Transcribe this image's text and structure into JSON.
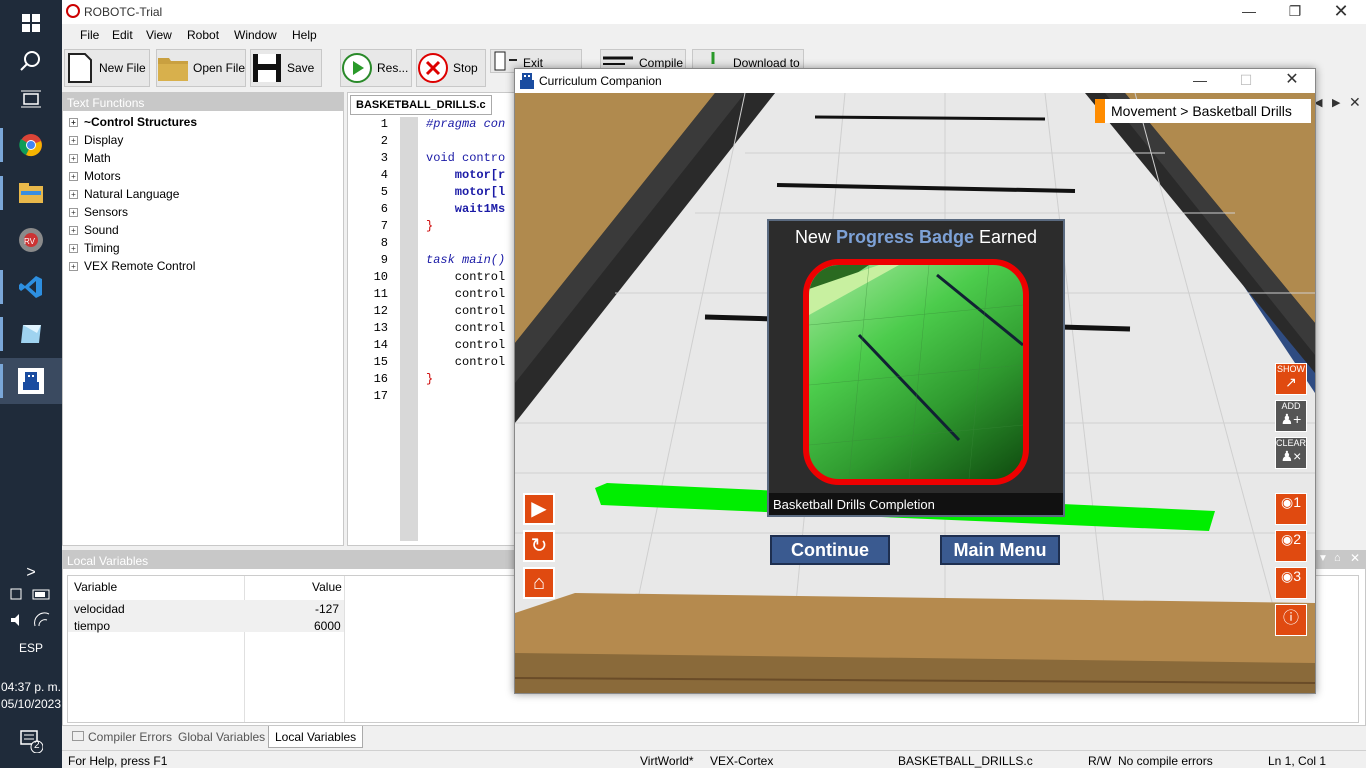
{
  "taskbar": {
    "time": "04:37 p. m.",
    "date": "05/10/2023",
    "language": "ESP",
    "notification_count": "2"
  },
  "window": {
    "title": "ROBOTC-Trial"
  },
  "menu": [
    "File",
    "Edit",
    "View",
    "Robot",
    "Window",
    "Help"
  ],
  "toolbar": {
    "new_file": "New File",
    "open_file": "Open File",
    "save": "Save",
    "resume": "Res...",
    "stop": "Stop",
    "exit": "Exit",
    "compile": "Compile",
    "download": "Download to"
  },
  "text_functions": {
    "header": "Text Functions",
    "items": [
      "~Control Structures",
      "Display",
      "Math",
      "Motors",
      "Natural Language",
      "Sensors",
      "Sound",
      "Timing",
      "VEX Remote Control"
    ]
  },
  "editor": {
    "tab": "BASKETBALL_DRILLS.c",
    "lines": [
      "#pragma con",
      "",
      "void contro",
      "    motor[r",
      "    motor[l",
      "    wait1Ms",
      "}",
      "",
      "task main()",
      "    control",
      "    control",
      "    control",
      "    control",
      "    control",
      "    control",
      "}",
      ""
    ]
  },
  "local_variables": {
    "header": "Local Variables",
    "col_variable": "Variable",
    "col_value": "Value",
    "rows": [
      {
        "name": "velocidad",
        "value": "-127"
      },
      {
        "name": "tiempo",
        "value": "6000"
      }
    ]
  },
  "bottom_tabs": [
    "Compiler Errors",
    "Global Variables",
    "Local Variables"
  ],
  "status": {
    "help": "For Help, press F1",
    "world": "VirtWorld*",
    "platform": "VEX-Cortex",
    "file": "BASKETBALL_DRILLS.c",
    "mode": "R/W",
    "compile": "No compile errors",
    "position": "Ln 1, Col 1"
  },
  "companion": {
    "title": "Curriculum Companion",
    "breadcrumb": "Movement > Basketball Drills",
    "badge_title_pre": "New ",
    "badge_title_hl": "Progress Badge",
    "badge_title_post": " Earned",
    "badge_caption": "Basketball Drills Completion",
    "continue": "Continue",
    "main_menu": "Main Menu",
    "show": "SHOW",
    "add": "ADD",
    "clear": "CLEAR",
    "cam1": "1",
    "cam2": "2",
    "cam3": "3"
  }
}
